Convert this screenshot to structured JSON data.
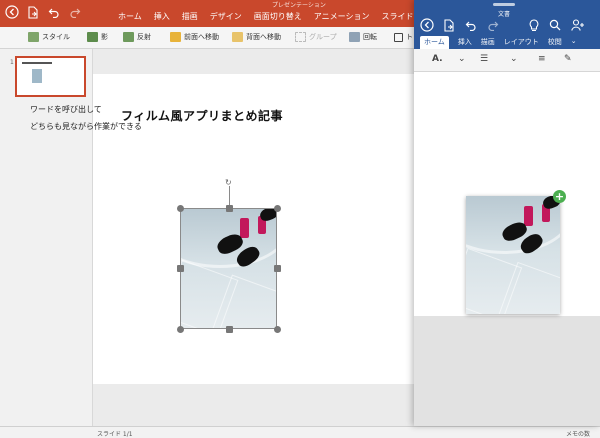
{
  "powerpoint": {
    "document_title": "プレゼンテーション",
    "tabs": [
      "ホーム",
      "挿入",
      "描画",
      "デザイン",
      "画面切り替え",
      "アニメーション",
      "スライド シ"
    ],
    "ribbon": {
      "style": "スタイル",
      "shadow": "影",
      "reflection": "反射",
      "bring_forward": "前面へ移動",
      "send_backward": "背面へ移動",
      "group": "グループ",
      "rotate": "回転",
      "arrange": "ト"
    },
    "slide_number": "1",
    "slide_title": "フィルム風アプリまとめ記事",
    "status_left": "スライド 1/1",
    "status_right": "メモの数"
  },
  "word": {
    "document_title": "文書",
    "tabs": [
      "ホーム",
      "挿入",
      "描画",
      "レイアウト",
      "校閲"
    ],
    "active_tab": "ホーム",
    "body_lines": [
      "ワードを呼び出して",
      "どちらも見ながら作業ができる"
    ],
    "drag_badge": "+"
  },
  "colors": {
    "ppt_accent": "#c9482c",
    "word_accent": "#2b579a",
    "drag_badge": "#4caf50"
  }
}
